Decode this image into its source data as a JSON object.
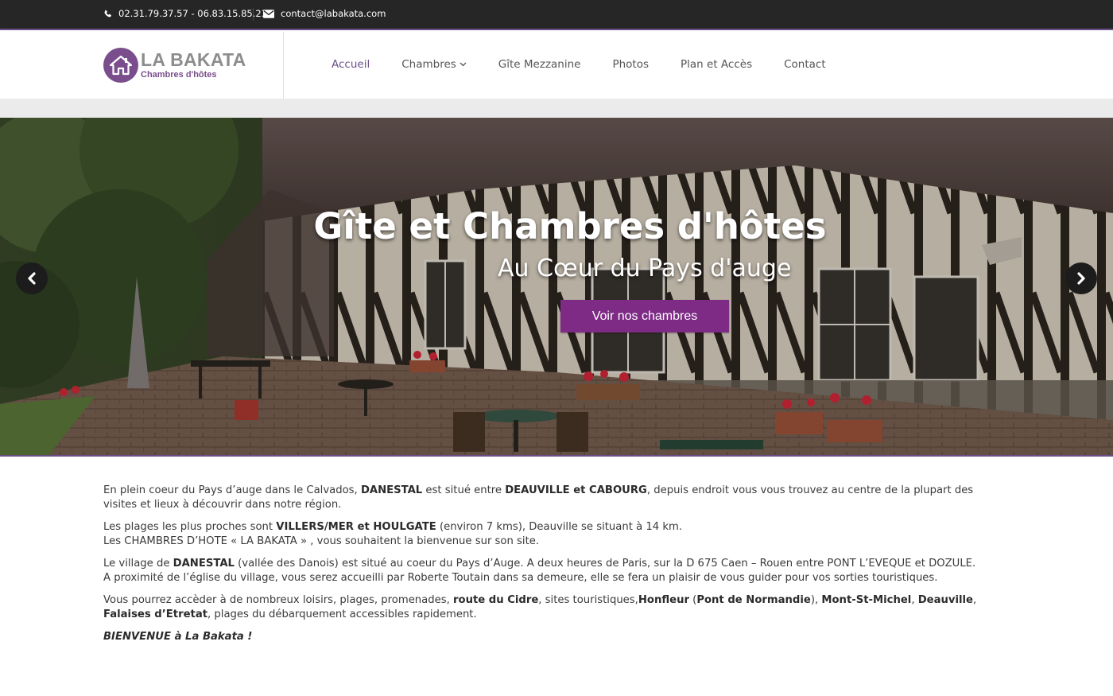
{
  "topbar": {
    "phone": "02.31.79.37.57 - 06.83.15.85.23",
    "email": "contact@labakata.com",
    "phone_icon": "phone-icon",
    "email_icon": "envelope-icon"
  },
  "logo": {
    "title": "LA BAKATA",
    "subtitle": "Chambres d'hôtes",
    "icon": "house-icon"
  },
  "nav": {
    "items": [
      {
        "label": "Accueil",
        "active": true
      },
      {
        "label": "Chambres",
        "has_dropdown": true
      },
      {
        "label": "Gîte Mezzanine"
      },
      {
        "label": "Photos"
      },
      {
        "label": "Plan et Accès"
      },
      {
        "label": "Contact"
      }
    ]
  },
  "hero": {
    "title": "Gîte et Chambres d'hôtes",
    "subtitle": "Au Cœur du Pays d'auge",
    "button": "Voir nos chambres",
    "prev_icon": "chevron-left-icon",
    "next_icon": "chevron-right-icon"
  },
  "content": {
    "p1": {
      "a": "En plein coeur du Pays d’auge dans le Calvados, ",
      "b1": "DANESTAL",
      "c": " est situé entre ",
      "b2": "DEAUVILLE et CABOURG",
      "d": ", depuis endroit vous vous trouvez au centre de la plupart des visites et lieux à découvrir dans notre région."
    },
    "p2": {
      "a": "Les plages les plus proches sont ",
      "b1": "VILLERS/MER et HOULGATE",
      "c": " (environ 7 kms), Deauville se situant à 14 km.",
      "d": "Les CHAMBRES D’HOTE « LA BAKATA » , vous souhaitent la bienvenue sur son site."
    },
    "p3": {
      "a": "Le village de ",
      "b1": "DANESTAL",
      "c": " (vallée des Danois) est situé au coeur du Pays d’Auge. A deux heures de Paris, sur la D 675 Caen – Rouen entre PONT L’EVEQUE et DOZULE.",
      "d": "A proximité de l’église du village, vous serez accueilli par Roberte Toutain dans sa demeure, elle se fera un plaisir de vous guider pour vos sorties touristiques."
    },
    "p4": {
      "a": "Vous pourrez accèder à de nombreux loisirs, plages, promenades, ",
      "b1": "route du Cidre",
      "c": ", sites touristiques,",
      "b2": "Honfleur",
      "d": " (",
      "b3": "Pont de Normandie",
      "e": "), ",
      "b4": "Mont-St-Michel",
      "f": ", ",
      "b5": "Deauville",
      "g": ", ",
      "b6": "Falaises d’Etretat",
      "h": ", plages du débarquement accessibles rapidement."
    },
    "welcome": "BIENVENUE à La Bakata !"
  }
}
